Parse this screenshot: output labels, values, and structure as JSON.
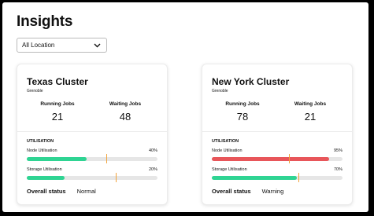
{
  "page": {
    "title": "Insights"
  },
  "filter": {
    "selected": "All Location"
  },
  "section_label": "UTILISATION",
  "colors": {
    "green": "#2fd493",
    "red": "#e8565a",
    "marker": "#f2a33a",
    "track": "#e6e6e6"
  },
  "cards": [
    {
      "title": "Texas Cluster",
      "subtitle": "Grenoble",
      "running_label": "Running Jobs",
      "running_value": "21",
      "waiting_label": "Waiting Jobs",
      "waiting_value": "48",
      "metrics": [
        {
          "label": "Node Utilisation",
          "value": "40%",
          "fill": 0.46,
          "color": "green",
          "marker": 0.61
        },
        {
          "label": "Storage Utilisation",
          "value": "20%",
          "fill": 0.29,
          "color": "green",
          "marker": 0.68
        }
      ],
      "status_label": "Overall status",
      "status_value": "Normal"
    },
    {
      "title": "New York Cluster",
      "subtitle": "Grenoble",
      "running_label": "Running Jobs",
      "running_value": "78",
      "waiting_label": "Waiting Jobs",
      "waiting_value": "21",
      "metrics": [
        {
          "label": "Node Utilisation",
          "value": "95%",
          "fill": 0.9,
          "color": "red",
          "marker": 0.59
        },
        {
          "label": "Storage Utilisation",
          "value": "70%",
          "fill": 0.65,
          "color": "green",
          "marker": 0.66
        }
      ],
      "status_label": "Overall status",
      "status_value": "Warning"
    }
  ]
}
